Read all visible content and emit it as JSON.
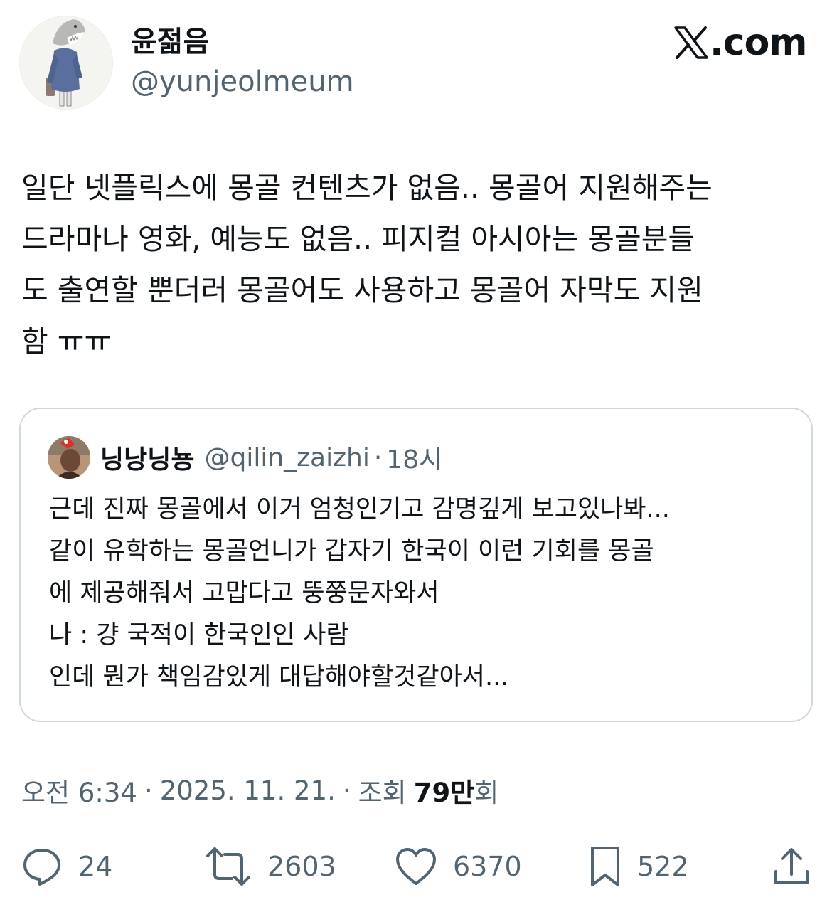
{
  "author": {
    "name": "윤젊음",
    "handle": "@yunjeolmeum"
  },
  "brand": {
    "label": ".com"
  },
  "tweet": {
    "lines": [
      "일단 넷플릭스에 몽골 컨텐츠가 없음.. 몽골어 지원해주는",
      "드라마나 영화, 예능도 없음.. 피지컬 아시아는 몽골분들",
      "도 출연할 뿐더러 몽골어도 사용하고 몽골어 자막도 지원",
      "함 ㅠㅠ"
    ]
  },
  "quote": {
    "name": "닝낭닝뇽",
    "handle": "@qilin_zaizhi",
    "separator": "·",
    "time": "18시",
    "lines": [
      "근데 진짜 몽골에서 이거 엄청인기고 감명깊게 보고있나봐...",
      "같이 유학하는 몽골언니가 갑자기 한국이 이런 기회를 몽골",
      "에 제공해줘서 고맙다고 뚱쭝문자와서",
      "나 : 걍 국적이 한국인인 사람",
      "인데 뭔가 책임감있게 대답해야할것같아서..."
    ]
  },
  "meta": {
    "time": "오전 6:34",
    "separator": "·",
    "date": "2025. 11. 21.",
    "views_label": "조회",
    "views_value": "79만",
    "views_suffix": "회"
  },
  "actions": {
    "replies": "24",
    "reposts": "2603",
    "likes": "6370",
    "bookmarks": "522"
  },
  "colors": {
    "text": "#0f1419",
    "secondary": "#536471",
    "border": "#cfd9de"
  }
}
